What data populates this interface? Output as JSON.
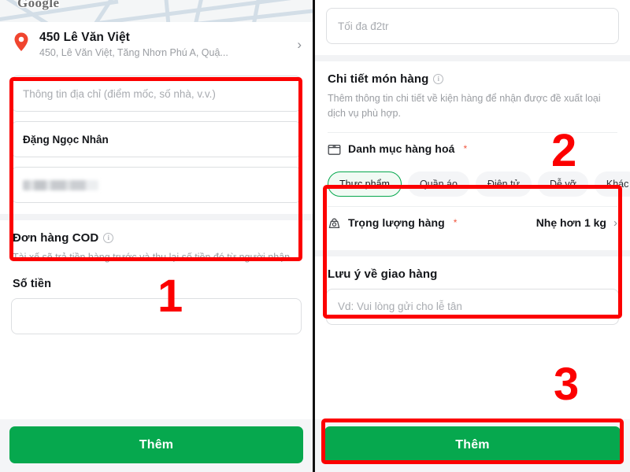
{
  "left_panel": {
    "map": {
      "logo_text": "Google",
      "icon": "google-maps-logo"
    },
    "address": {
      "pin_icon": "map-pin-icon",
      "title": "450 Lê Văn Việt",
      "subtitle": "450, Lê Văn Việt, Tăng Nhơn Phú A, Quậ...",
      "chevron_icon": "chevron-right-icon"
    },
    "fields": {
      "address_detail_placeholder": "Thông tin địa chỉ (điểm mốc, số nhà, v.v.)",
      "contact_name_value": "Đặng Ngọc Nhân",
      "phone_value_redacted": "•••••••••••"
    },
    "cod": {
      "title": "Đơn hàng COD",
      "info_icon": "info-icon",
      "description": "Tài xế sẽ trả tiền hàng trước và thu lại số tiền đó từ người nhận.",
      "amount_label": "Số tiền",
      "amount_value": ""
    },
    "cta_label": "Thêm"
  },
  "right_panel": {
    "amount_input_placeholder": "Tối đa đ2tr",
    "item_details": {
      "title": "Chi tiết món hàng",
      "info_icon": "info-icon",
      "description": "Thêm thông tin chi tiết về kiện hàng để nhận được đề xuất loại dịch vụ phù hợp."
    },
    "category": {
      "icon": "package-box-icon",
      "label": "Danh mục hàng hoá",
      "required_mark": "*",
      "options": [
        "Thực phẩm",
        "Quần áo",
        "Điện tử",
        "Dễ vỡ",
        "Khác"
      ],
      "selected": "Thực phẩm"
    },
    "weight": {
      "icon": "weight-scale-icon",
      "label": "Trọng lượng hàng",
      "required_mark": "*",
      "value": "Nhẹ hơn 1 kg",
      "chevron_icon": "chevron-right-icon"
    },
    "delivery_note": {
      "label": "Lưu ý về giao hàng",
      "placeholder": "Vd: Vui lòng gửi cho lễ tân",
      "value": ""
    },
    "cta_label": "Thêm"
  },
  "annotations": {
    "step1": "1",
    "step2": "2",
    "step3": "3",
    "color": "#fc0000"
  }
}
